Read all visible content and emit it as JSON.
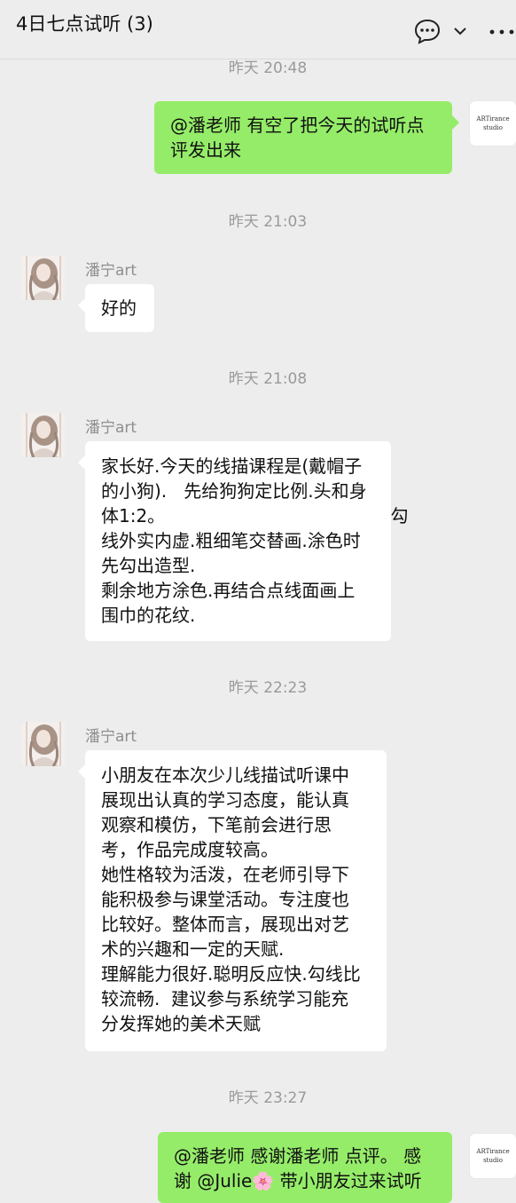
{
  "header": {
    "title": "4日七点试听 (3)"
  },
  "self_avatar": {
    "line1": "ARTirance",
    "line2": "studio"
  },
  "timestamps": [
    "昨天 20:48",
    "昨天 21:03",
    "昨天 21:08",
    "昨天 22:23",
    "昨天 23:27"
  ],
  "messages": [
    {
      "sender": "",
      "lines": [
        "@潘老师 有空了把今天的试听点",
        "评发出来"
      ]
    },
    {
      "sender": "潘宁art",
      "lines": [
        "好的"
      ]
    },
    {
      "sender": "潘宁art",
      "lines": [
        "家长好.今天的线描课程是(戴帽子",
        "的小狗).   先给狗狗定比例.头和身",
        "体1:2。                                        勾",
        "线外实内虚.粗细笔交替画.涂色时",
        "先勾出造型.",
        "剩余地方涂色.再结合点线面画上",
        "围巾的花纹."
      ]
    },
    {
      "sender": "潘宁art",
      "lines": [
        "小朋友在本次少儿线描试听课中",
        "展现出认真的学习态度，能认真",
        "观察和模仿，下笔前会进行思",
        "考，作品完成度较高。",
        "她性格较为活泼，在老师引导下",
        "能积极参与课堂活动。专注度也",
        "比较好。整体而言，展现出对艺",
        "术的兴趣和一定的天赋.",
        "理解能力很好.聪明反应快.勾线比",
        "较流畅.  建议参与系统学习能充",
        "分发挥她的美术天赋"
      ]
    },
    {
      "sender": "",
      "lines": [
        "@潘老师 感谢潘老师 点评。 感",
        "谢 @Julie",
        " 带小朋友过来试听"
      ],
      "emoji": "🌸"
    }
  ],
  "icons": [
    "chat-bubble-icon",
    "chevron-down-icon",
    "more-icon"
  ]
}
